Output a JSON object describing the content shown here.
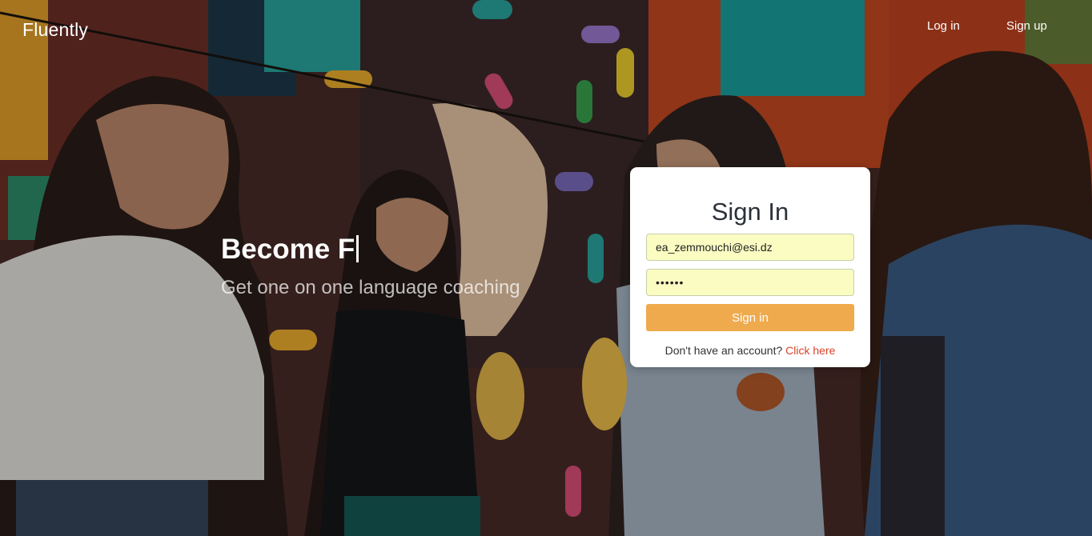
{
  "nav": {
    "brand": "Fluently",
    "login_label": "Log in",
    "signup_label": "Sign up"
  },
  "hero": {
    "headline": "Become F",
    "tagline": "Get one on one language coaching"
  },
  "signin": {
    "title": "Sign In",
    "email_value": "ea_zemmouchi@esi.dz",
    "password_value": "••••••",
    "submit_label": "Sign in",
    "prompt_text": "Don't have an account?",
    "link_text": "Click here"
  },
  "colors": {
    "button": "#efaa4d",
    "link": "#d9442b",
    "field_fill": "#fafcc2",
    "text": "#2b3139"
  },
  "icons": {
    "caret": "text-cursor"
  }
}
